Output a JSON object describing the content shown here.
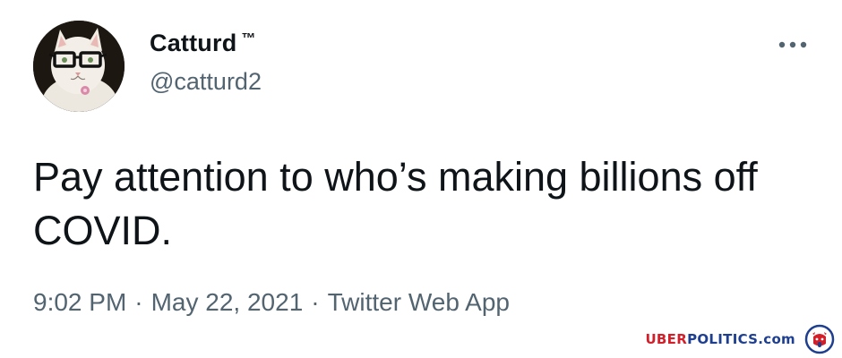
{
  "tweet": {
    "author": {
      "display_name": "Catturd",
      "trademark": "™",
      "handle": "@catturd2",
      "avatar_icon": "cat-with-glasses-avatar"
    },
    "more_icon": "more-options-icon",
    "text": "Pay attention to who’s making billions off COVID.",
    "time": "9:02 PM",
    "separator": "·",
    "date": "May 22, 2021",
    "source": "Twitter Web App"
  },
  "watermark": {
    "brand_red": "UBER",
    "brand_blue": "POLITICS",
    "brand_suffix": ".com",
    "logo_icon": "elephant-circle-logo"
  },
  "colors": {
    "text_primary": "#0f1419",
    "text_secondary": "#536471",
    "watermark_red": "#d21f2a",
    "watermark_blue": "#1e3f8f"
  }
}
